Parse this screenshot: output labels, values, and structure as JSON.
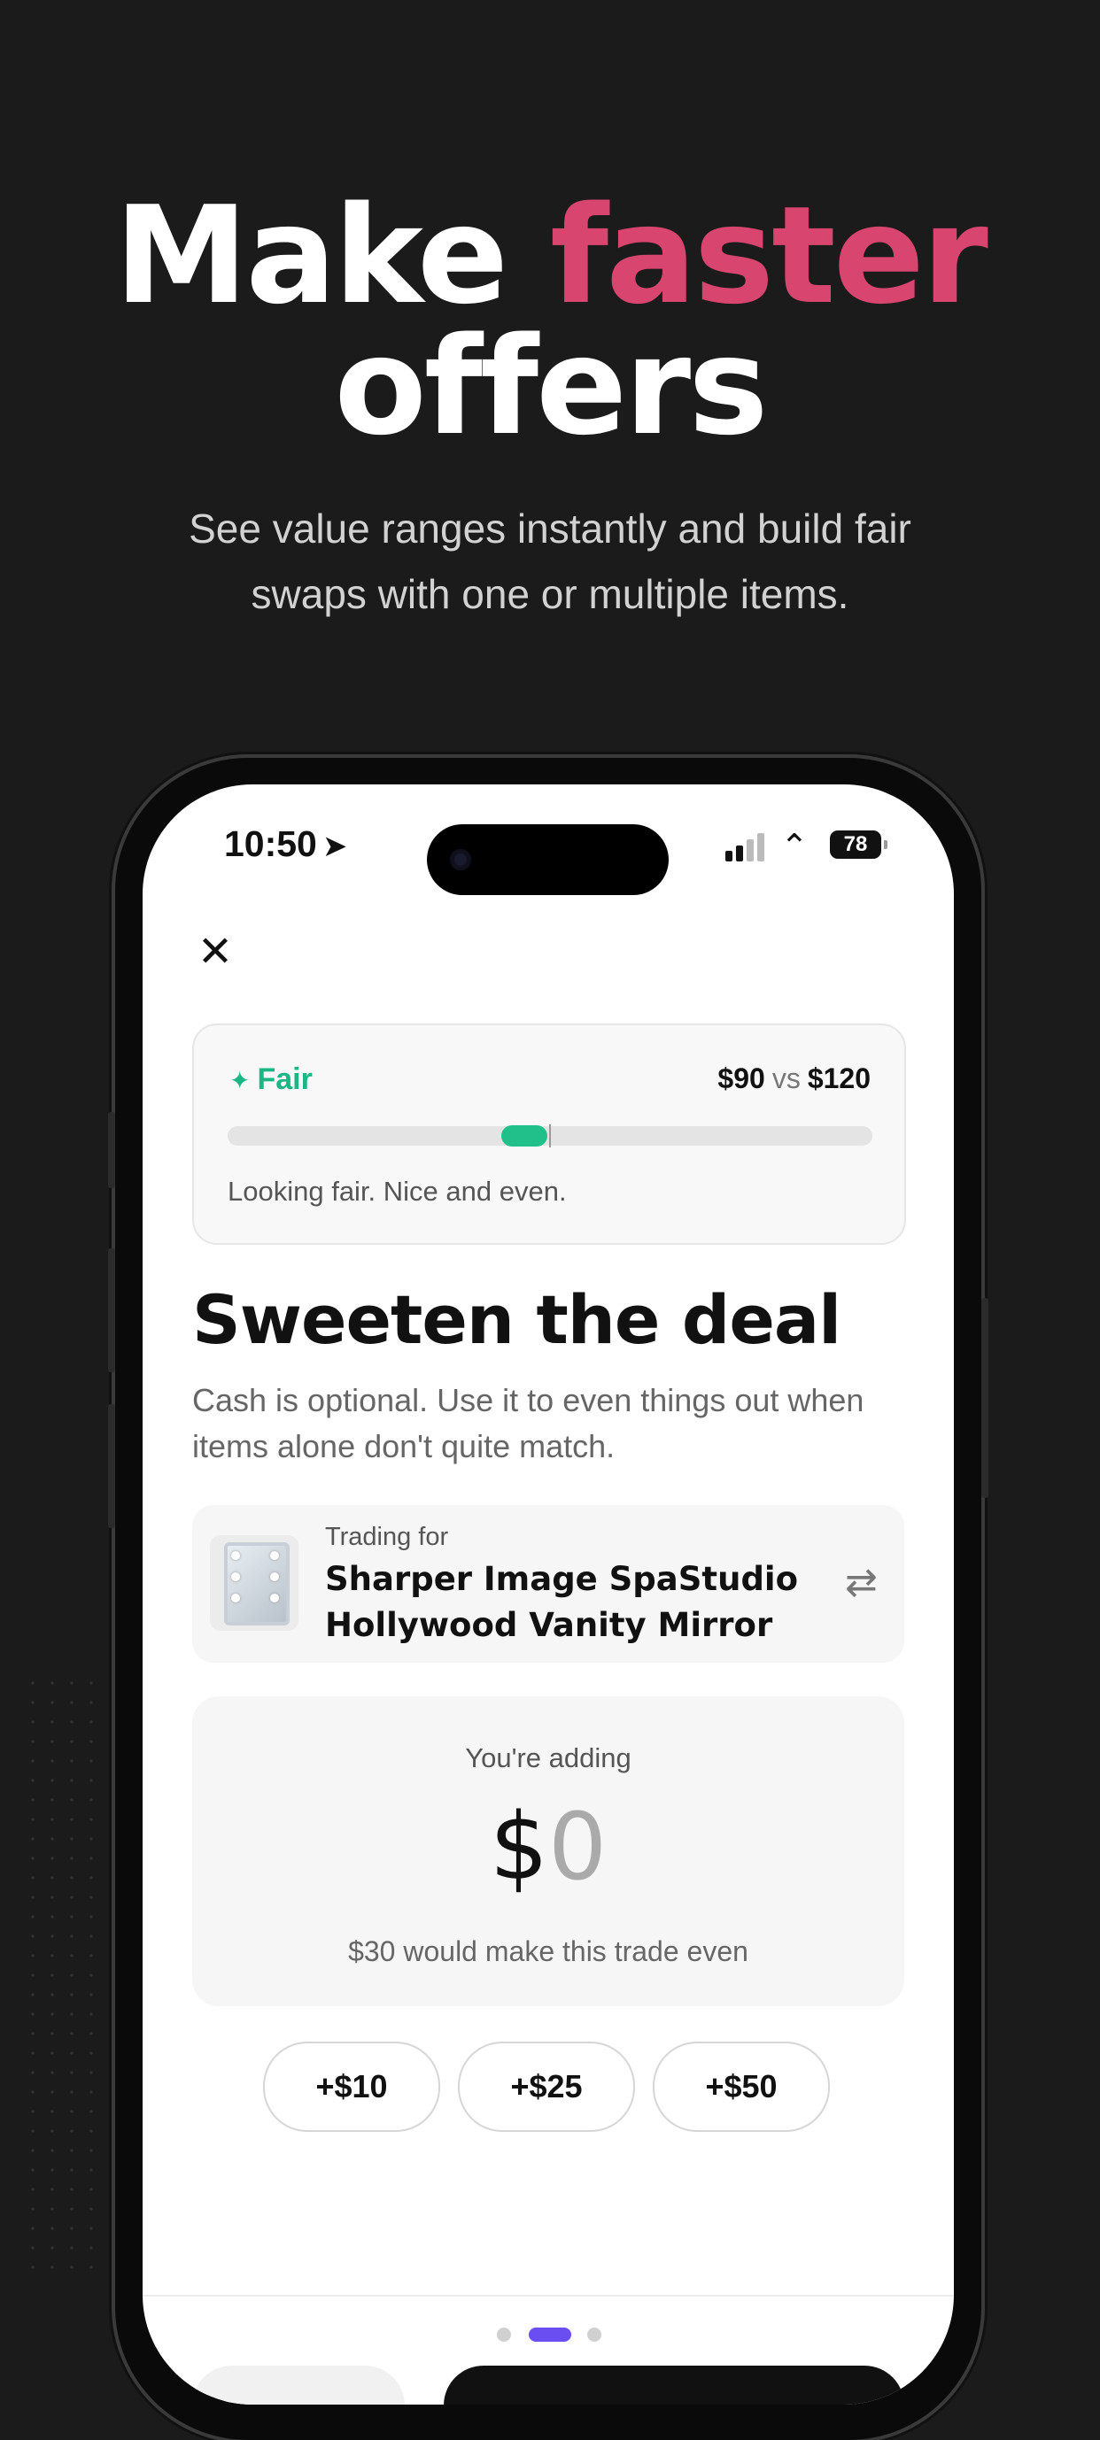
{
  "hero": {
    "title_line1_plain": "Make",
    "title_line1_accent": "faster",
    "title_line2": "offers",
    "subtitle_line1": "See value ranges instantly and build fair",
    "subtitle_line2": "swaps with one or multiple items."
  },
  "colors": {
    "background": "#1b1b1c",
    "accent_pink": "#d8456f",
    "fair_green": "#21c08a",
    "pager_active": "#6b4ef2"
  },
  "status_bar": {
    "time": "10:50",
    "battery": "78",
    "icons": [
      "location-arrow-icon",
      "signal-icon",
      "wifi-icon",
      "battery-icon"
    ]
  },
  "screen": {
    "close_icon": "close-icon",
    "fairness": {
      "label": "Fair",
      "your_value": "$90",
      "vs": "vs",
      "their_value": "$120",
      "balance_position": 0.46,
      "caption": "Looking fair. Nice and even."
    },
    "section": {
      "title": "Sweeten the deal",
      "description": "Cash is optional. Use it to even things out when items alone don't quite match."
    },
    "trade": {
      "label": "Trading for",
      "item_name_line1": "Sharper Image SpaStudio",
      "item_name_line2": "Hollywood Vanity Mirror",
      "swap_icon": "swap-icon"
    },
    "adding": {
      "label": "You're adding",
      "currency": "$",
      "amount": "0",
      "hint": "$30 would make this trade even"
    },
    "quick_add": [
      "+$10",
      "+$25",
      "+$50"
    ],
    "pager": {
      "pages": 3,
      "active": 2
    }
  }
}
